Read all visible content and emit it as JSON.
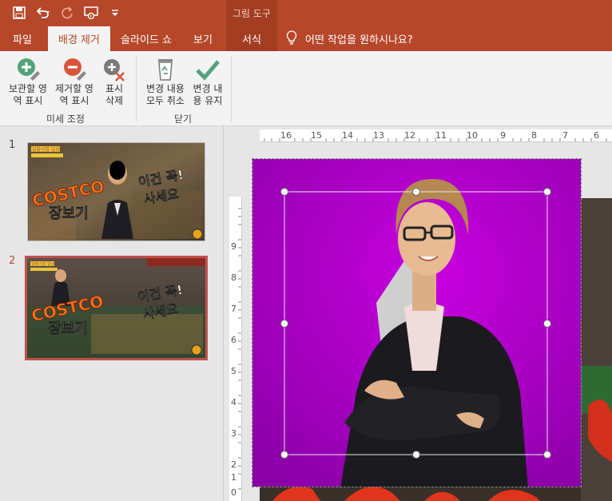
{
  "titlebar": {
    "context_group": "그림 도구",
    "qat": [
      "save-icon",
      "undo-icon",
      "redo-icon",
      "slideshow-icon",
      "customize-icon"
    ]
  },
  "tabs": {
    "file": "파일",
    "background_removal": "배경 제거",
    "slideshow": "슬라이드 쇼",
    "view": "보기",
    "format": "서식",
    "tell_me": "어떤 작업을 원하시나요?"
  },
  "ribbon": {
    "mark_keep": "보관할 영\n역 표시",
    "mark_remove": "제거할 영\n역 표시",
    "delete_mark": "표시\n삭제",
    "discard_all": "변경 내용\n모두 취소",
    "keep_changes": "변경 내\n용 유지",
    "group_refine": "미세 조정",
    "group_close": "닫기"
  },
  "slides": [
    {
      "number": "1",
      "tag1": "알쓸신잡 일상",
      "tag2": "COSTCO",
      "title": "장보기",
      "text1": "이건 꼭!",
      "text2": "사세요"
    },
    {
      "number": "2",
      "tag1": "알쓸신잡 일상",
      "tag2": "COSTCO",
      "title": "장보기",
      "text1": "이건 꼭!",
      "text2": "사세요"
    }
  ],
  "ruler": {
    "h": [
      "16",
      "15",
      "14",
      "13",
      "12",
      "11",
      "10",
      "9",
      "8",
      "7",
      "6"
    ],
    "v": [
      "9",
      "8",
      "7",
      "6",
      "5",
      "4",
      "3",
      "2",
      "1",
      "0"
    ]
  },
  "colors": {
    "accent": "#b7472a",
    "magenta": "#b000c8"
  }
}
